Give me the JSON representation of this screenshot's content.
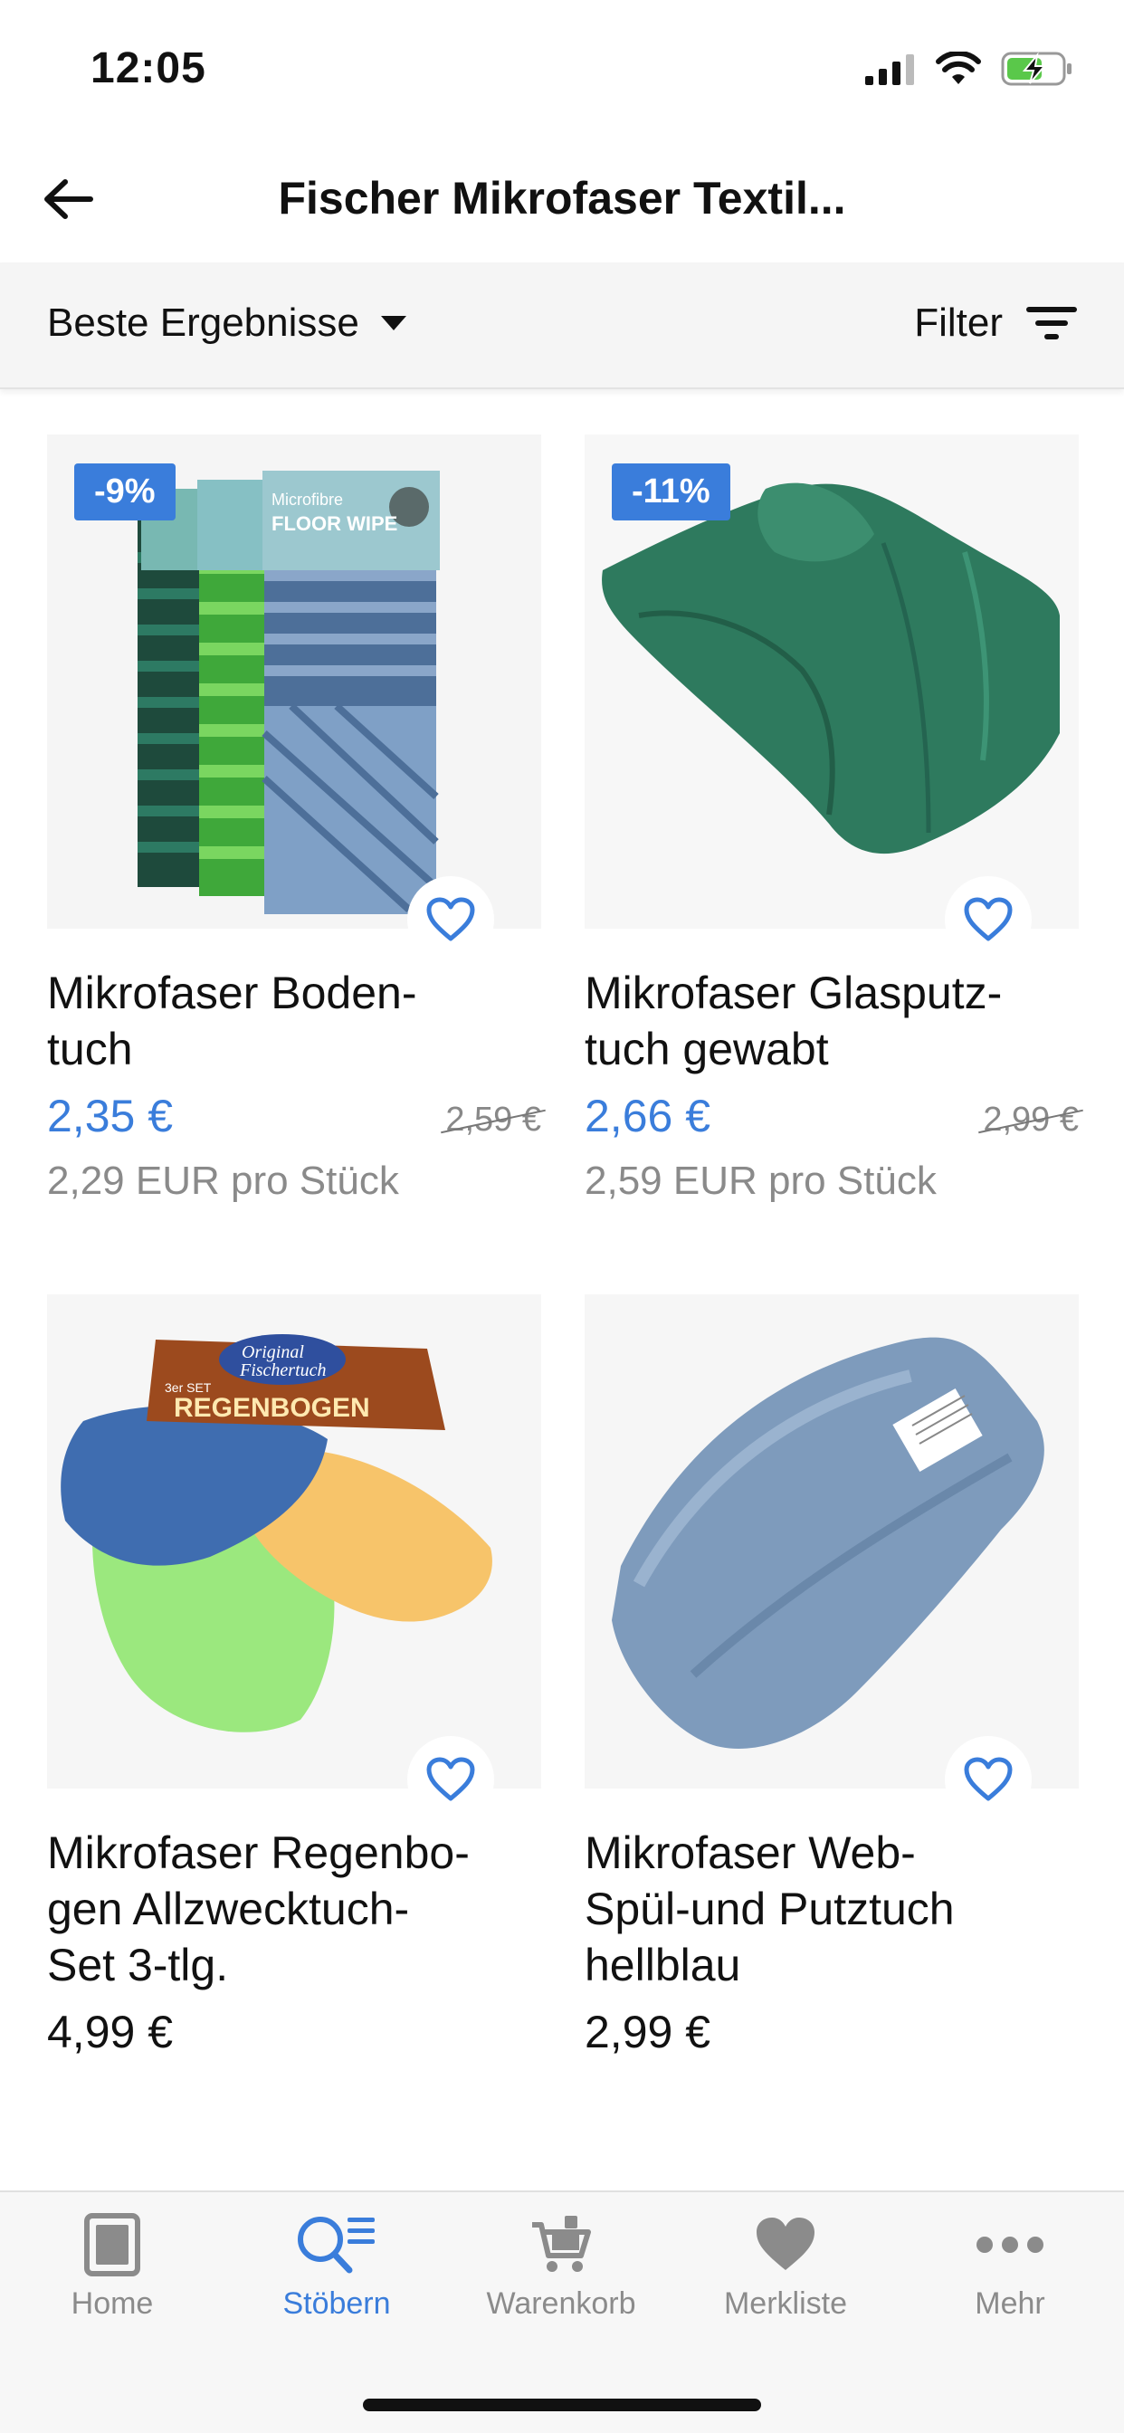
{
  "status": {
    "time": "12:05"
  },
  "header": {
    "title": "Fischer Mikrofaser Textil..."
  },
  "sort_bar": {
    "sort_label": "Beste Ergebnisse",
    "filter_label": "Filter"
  },
  "products": [
    {
      "title": "Mikrofaser Boden-\ntuch",
      "badge": "-9%",
      "price": "2,35 €",
      "old_price": "2,59 €",
      "unit_price": "2,29 EUR pro Stück"
    },
    {
      "title": "Mikrofaser Glasputz-\ntuch gewabt",
      "badge": "-11%",
      "price": "2,66 €",
      "old_price": "2,99 €",
      "unit_price": "2,59 EUR pro Stück"
    },
    {
      "title": "Mikrofaser Regenbo-\ngen Allzwecktuch-\nSet 3-tlg.",
      "price": "4,99 €"
    },
    {
      "title": "Mikrofaser Web-\nSpül-und Putztuch\nhellblau",
      "price": "2,99 €"
    }
  ],
  "product_images": {
    "floor_wipe_package": [
      "Microfibre",
      "FLOOR WIPE"
    ],
    "rainbow_package": [
      "Original",
      "Fischertuch",
      "3er SET",
      "REGENBOGEN"
    ]
  },
  "tabs": [
    {
      "label": "Home",
      "icon": "home-icon"
    },
    {
      "label": "Stöbern",
      "icon": "search-list-icon",
      "active": true
    },
    {
      "label": "Warenkorb",
      "icon": "cart-icon"
    },
    {
      "label": "Merkliste",
      "icon": "heart-icon"
    },
    {
      "label": "Mehr",
      "icon": "more-icon"
    }
  ],
  "colors": {
    "accent": "#3a7ddb",
    "text": "#111111",
    "muted": "#8a8a8a"
  }
}
